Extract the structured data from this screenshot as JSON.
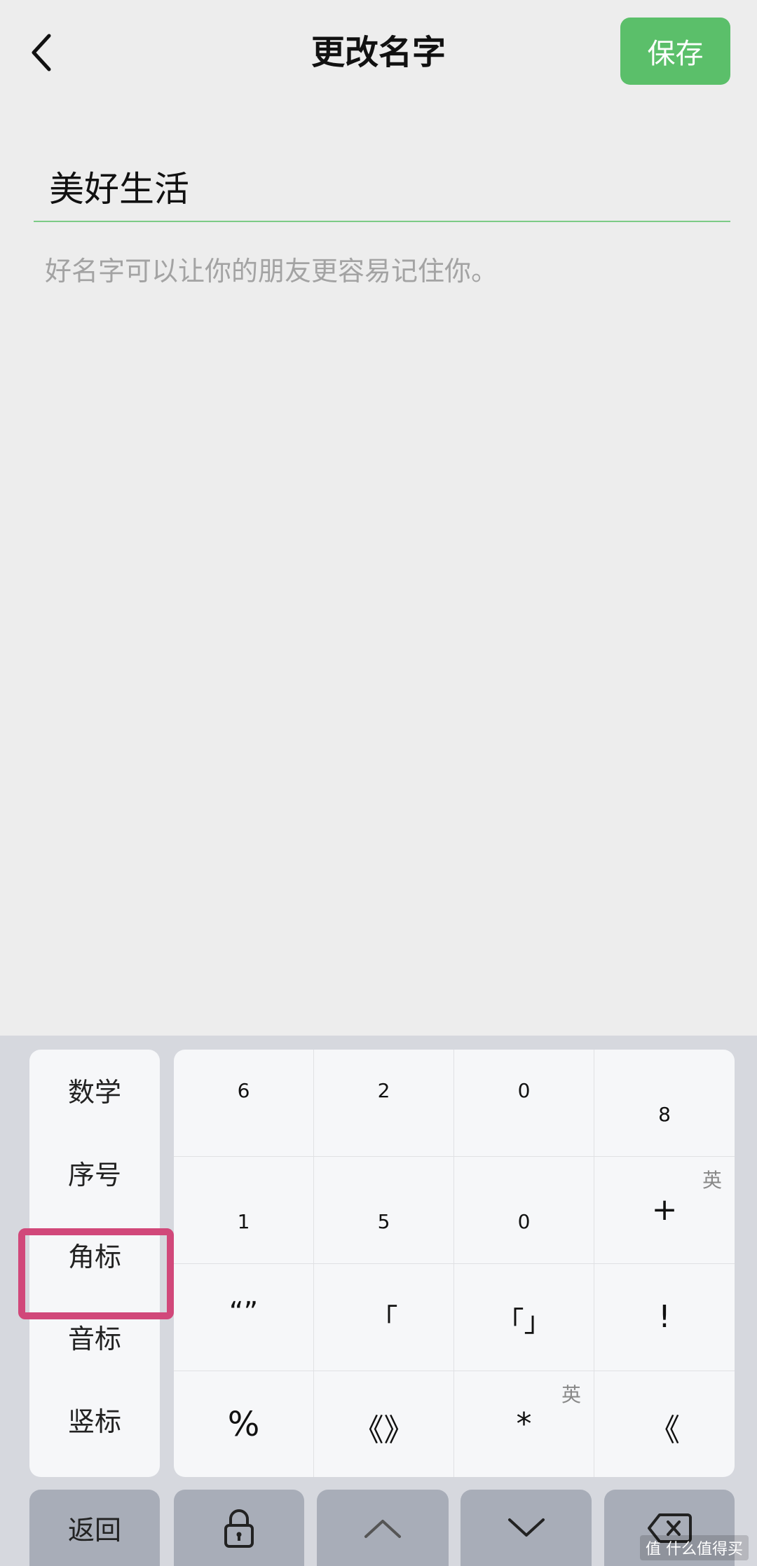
{
  "header": {
    "title": "更改名字",
    "save_label": "保存",
    "back_icon": "chevron-left-icon"
  },
  "form": {
    "name_value": "美好生活",
    "hint": "好名字可以让你的朋友更容易记住你。"
  },
  "keyboard": {
    "categories": [
      "数学",
      "序号",
      "角标",
      "音标",
      "竖标"
    ],
    "highlighted_category": "角标",
    "highlight_color": "#d1487a",
    "cells": [
      [
        "6",
        "2",
        "0",
        "8"
      ],
      [
        "1",
        "5",
        "0",
        "+"
      ],
      [
        "“”",
        "「",
        "「」",
        "!"
      ],
      [
        "%",
        "《》",
        "*",
        "《"
      ]
    ],
    "cell_badges": {
      "r1c3": "英",
      "r3c2": "英"
    },
    "bottom": {
      "back_label": "返回",
      "lock_icon": "lock-icon",
      "up_icon": "chevron-up-icon",
      "down_icon": "chevron-down-icon",
      "delete_icon": "backspace-icon"
    }
  },
  "watermark": "值 什么值得买",
  "colors": {
    "accent": "#5bbf6a",
    "background": "#ededed"
  }
}
